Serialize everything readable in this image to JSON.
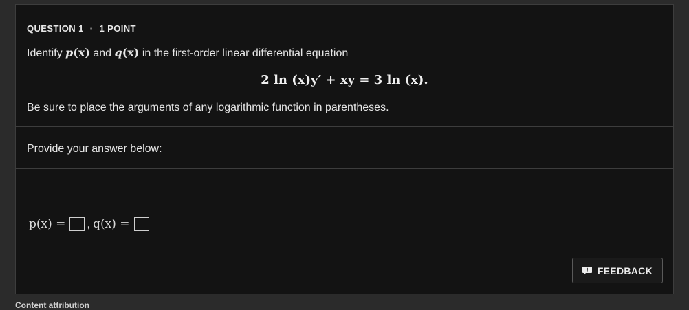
{
  "question": {
    "number_label": "QUESTION 1",
    "separator": "·",
    "points_label": "1 POINT",
    "prompt": {
      "before": "Identify ",
      "p": "p",
      "arg1": "(x)",
      "middle": " and ",
      "q": "q",
      "arg2": "(x)",
      "after": " in the first-order linear differential equation"
    },
    "equation": "2 ln (x)y′ + xy = 3 ln (x).",
    "note": "Be sure to place the arguments of any logarithmic function in parentheses."
  },
  "answer": {
    "provide_label": "Provide your answer below:",
    "p_label": "p(x) =",
    "q_label": "q(x) =",
    "separator": ","
  },
  "feedback": {
    "label": "FEEDBACK",
    "icon": "speech-bubble-exclamation-icon"
  },
  "footer": {
    "attribution": "Content attribution"
  }
}
